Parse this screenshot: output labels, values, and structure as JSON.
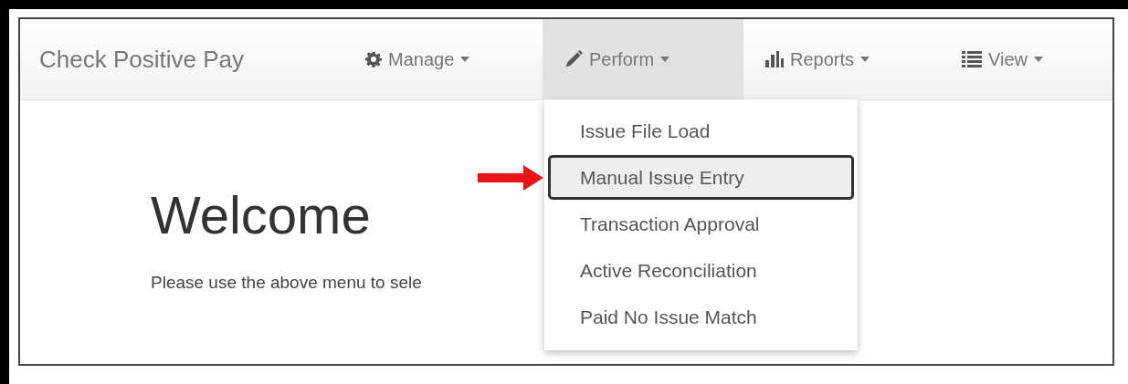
{
  "navbar": {
    "brand": "Check Positive Pay",
    "items": [
      {
        "label": "Manage",
        "selected": false
      },
      {
        "label": "Perform",
        "selected": true
      },
      {
        "label": "Reports",
        "selected": false
      },
      {
        "label": "View",
        "selected": false
      }
    ]
  },
  "dropdown": {
    "items": [
      {
        "label": "Issue File Load",
        "selected": false
      },
      {
        "label": "Manual Issue Entry",
        "selected": true
      },
      {
        "label": "Transaction Approval",
        "selected": false
      },
      {
        "label": "Active Reconciliation",
        "selected": false
      },
      {
        "label": "Paid No Issue Match",
        "selected": false
      }
    ]
  },
  "content": {
    "heading": "Welcome",
    "text": "Please use the above menu to sele"
  }
}
